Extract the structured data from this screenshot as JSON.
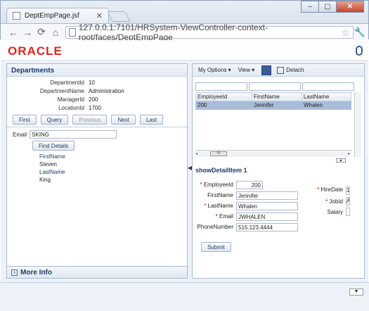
{
  "browser": {
    "tab_title": "DeptEmpPage.jsf",
    "tab_close": "✕",
    "url": "127.0.0.1:7101/HRSystem-ViewController-context-root/faces/DeptEmpPage",
    "window_minimize": "‒",
    "window_maximize": "▢",
    "window_close": "✕"
  },
  "header": {
    "logo": "ORACLE"
  },
  "departments": {
    "title": "Departments",
    "fields": [
      {
        "label": "DepartmentId",
        "value": "10"
      },
      {
        "label": "DepartmentName",
        "value": "Administration"
      },
      {
        "label": "ManagerId",
        "value": "200"
      },
      {
        "label": "LocationId",
        "value": "1700"
      }
    ],
    "buttons": {
      "first": "First",
      "query": "Query",
      "previous": "Previous",
      "next": "Next",
      "last": "Last"
    },
    "email_label": "Email",
    "email_value": "SKING",
    "find_details": "Find Details",
    "details": {
      "firstname_label": "FirstName",
      "firstname_value": "Steven",
      "lastname_label": "LastName",
      "lastname_value": "King"
    }
  },
  "more_info": "More Info",
  "employees": {
    "toolbar": {
      "my_options": "My Options ▾",
      "view": "View ▾",
      "detach": "Detach"
    },
    "columns": [
      "EmployeeId",
      "FirstName",
      "LastName"
    ],
    "rows": [
      [
        "200",
        "Jennifer",
        "Whalen"
      ]
    ],
    "scroll_left": "◂",
    "scroll_right": "▸",
    "scroll_grip": "III"
  },
  "detail": {
    "title": "showDetailItem 1",
    "employee_id_label": "EmployeeId",
    "employee_id": "200",
    "firstname_label": "FirstName",
    "firstname": "Jennifer",
    "lastname_label": "LastName",
    "lastname": "Whalen",
    "email_label": "Email",
    "email": "JWHALEN",
    "phone_label": "PhoneNumber",
    "phone": "515.123.4444",
    "hiredate_label": "HireDate",
    "hiredate_value": "1",
    "jobid_label": "JobId",
    "jobid_value": "A",
    "salary_label": "Salary",
    "submit": "Submit"
  }
}
